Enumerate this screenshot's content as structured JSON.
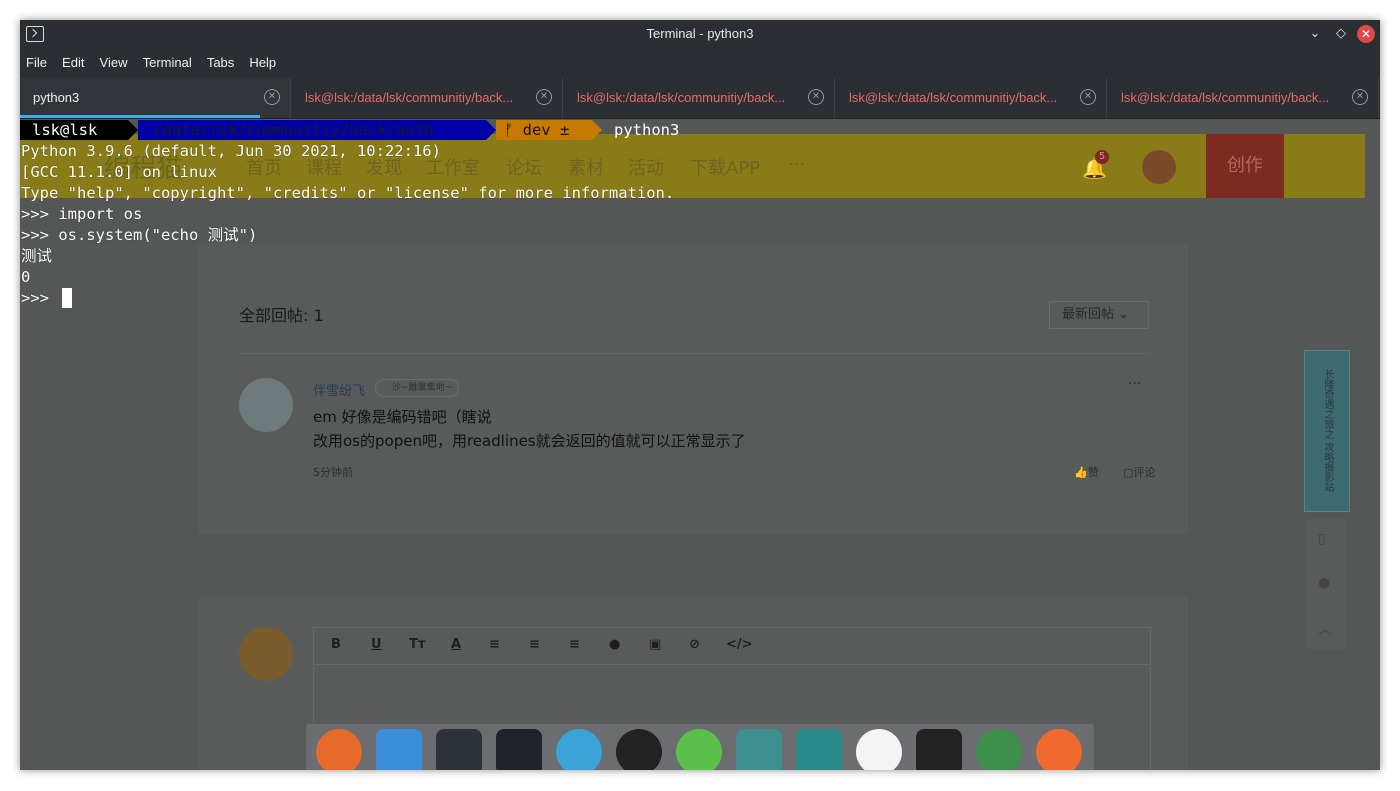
{
  "window": {
    "title": "Terminal - python3",
    "controls": {
      "minimize": "⌄",
      "maximize": "◇",
      "close": "✕"
    }
  },
  "menu": [
    "File",
    "Edit",
    "View",
    "Terminal",
    "Tabs",
    "Help"
  ],
  "tabs": [
    {
      "label": "python3",
      "active": true
    },
    {
      "label": "lsk@lsk:/data/lsk/communitiy/back...",
      "active": false
    },
    {
      "label": "lsk@lsk:/data/lsk/communitiy/back...",
      "active": false
    },
    {
      "label": "lsk@lsk:/data/lsk/communitiy/back...",
      "active": false
    },
    {
      "label": "lsk@lsk:/data/lsk/communitiy/back...",
      "active": false
    }
  ],
  "terminal": {
    "prompt": {
      "user": "lsk@lsk",
      "path": " /data/lsk/communitiy/back/auth",
      "git": "ᚠ dev ±",
      "command": "python3"
    },
    "lines": [
      "Python 3.9.6 (default, Jun 30 2021, 10:22:16)",
      "[GCC 11.1.0] on linux",
      "Type \"help\", \"copyright\", \"credits\" or \"license\" for more information.",
      ">>> import os",
      ">>> os.system(\"echo 测试\")",
      "测试",
      "0",
      ">>> "
    ]
  },
  "background_page": {
    "nav": [
      "编程猫",
      "首页",
      "课程",
      "发现",
      "工作室",
      "论坛",
      "素材",
      "活动",
      "下载APP",
      "···"
    ],
    "notification_count": "5",
    "create_button": "创作",
    "replies_title": "全部回帖: 1",
    "sort_dropdown": "最新回帖",
    "reply": {
      "user": "伴雪纷飞",
      "tag": "沙~雕聚集地~",
      "line1": "em 好像是编码错吧（瞎说",
      "line2": "改用os的popen吧，用readlines就会返回的值就可以正常显示了",
      "time": "5分钟前",
      "like": "赞",
      "comment": "评论",
      "more": "···"
    },
    "editor_tools": [
      "B",
      "U",
      "Tт",
      "A",
      "≡",
      "≡",
      "≡",
      "●",
      "▣",
      "⊘",
      "</>"
    ],
    "banner_text": "长隆奇遇之旅之 攻略摄影站"
  },
  "dock": [
    {
      "name": "firefox-icon",
      "color": "#e66b2a"
    },
    {
      "name": "file-manager-icon",
      "color": "#3a8fd8"
    },
    {
      "name": "settings-icon",
      "color": "#2d3238"
    },
    {
      "name": "terminal-icon",
      "color": "#1f2227"
    },
    {
      "name": "telegram-icon",
      "color": "#3aa3d8"
    },
    {
      "name": "qq-icon",
      "color": "#222222"
    },
    {
      "name": "wechat-icon",
      "color": "#5ac04a"
    },
    {
      "name": "screenshot-icon",
      "color": "#3e8f8f"
    },
    {
      "name": "tape-icon",
      "color": "#2a8a8a"
    },
    {
      "name": "beaver-icon",
      "color": "#f4f4f4"
    },
    {
      "name": "intellij-icon",
      "color": "#222222"
    },
    {
      "name": "android-studio-icon",
      "color": "#3e8f4a"
    },
    {
      "name": "postman-icon",
      "color": "#f06a30"
    }
  ]
}
